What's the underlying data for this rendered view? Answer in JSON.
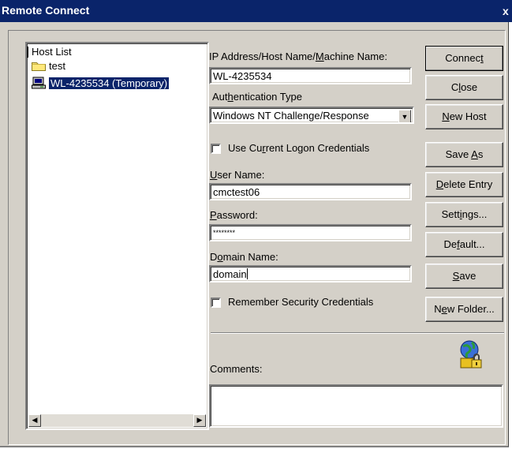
{
  "window": {
    "title": "Remote Connect",
    "close_glyph": "x"
  },
  "tree": {
    "root_label": "Host List",
    "items": [
      {
        "label": "test",
        "icon": "folder-icon"
      },
      {
        "label": "WL-4235534 (Temporary)",
        "icon": "computer-icon",
        "selected": true
      }
    ]
  },
  "form": {
    "ip_label_pre": "IP Address/Host Name/",
    "ip_label_u": "M",
    "ip_label_post": "achine Name:",
    "ip_value": "WL-4235534",
    "auth_label_pre": "Aut",
    "auth_label_u": "h",
    "auth_label_post": "entication Type",
    "auth_value": "Windows NT Challenge/Response",
    "use_current_label_pre": "Use Cu",
    "use_current_label_u": "r",
    "use_current_label_post": "rent Logon Credentials",
    "user_label_u": "U",
    "user_label_post": "ser Name:",
    "user_value": "cmctest06",
    "password_label_u": "P",
    "password_label_post": "assword:",
    "password_value": "********",
    "domain_label_pre": "D",
    "domain_label_u": "o",
    "domain_label_post": "main Name:",
    "domain_value": "domain",
    "remember_label": "Remember Security Credentials",
    "comments_label": "Comments:",
    "comments_value": ""
  },
  "buttons": {
    "connect_pre": "Connec",
    "connect_u": "t",
    "connect_post": "",
    "close_pre": "C",
    "close_u": "l",
    "close_post": "ose",
    "new_host_pre": "",
    "new_host_u": "N",
    "new_host_post": "ew Host",
    "save_as_pre": "Save ",
    "save_as_u": "A",
    "save_as_post": "s",
    "delete_pre": "",
    "delete_u": "D",
    "delete_post": "elete Entry",
    "settings_pre": "Sett",
    "settings_u": "i",
    "settings_post": "ngs...",
    "default_pre": "De",
    "default_u": "f",
    "default_post": "ault...",
    "save_pre": "",
    "save_u": "S",
    "save_post": "ave",
    "new_folder_pre": "N",
    "new_folder_u": "e",
    "new_folder_post": "w Folder..."
  }
}
